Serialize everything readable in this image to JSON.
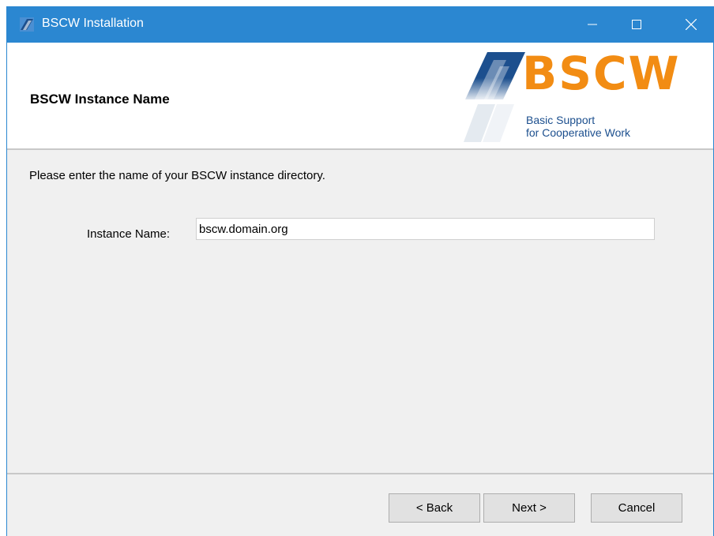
{
  "window": {
    "title": "BSCW Installation",
    "controls": [
      "minimize",
      "maximize",
      "close"
    ]
  },
  "header": {
    "title": "BSCW Instance Name",
    "logo": {
      "wordmark": "BSCW",
      "tagline_line1": "Basic Support",
      "tagline_line2": "for Cooperative Work"
    }
  },
  "content": {
    "prompt": "Please enter the name of your BSCW instance directory.",
    "instance_label": "Instance Name:",
    "instance_value": "bscw.domain.org"
  },
  "buttons": {
    "back": "< Back",
    "next": "Next >",
    "cancel": "Cancel"
  },
  "colors": {
    "titlebar": "#2b87d1",
    "logo_orange": "#f28c13",
    "logo_blue": "#1c4f8e"
  }
}
